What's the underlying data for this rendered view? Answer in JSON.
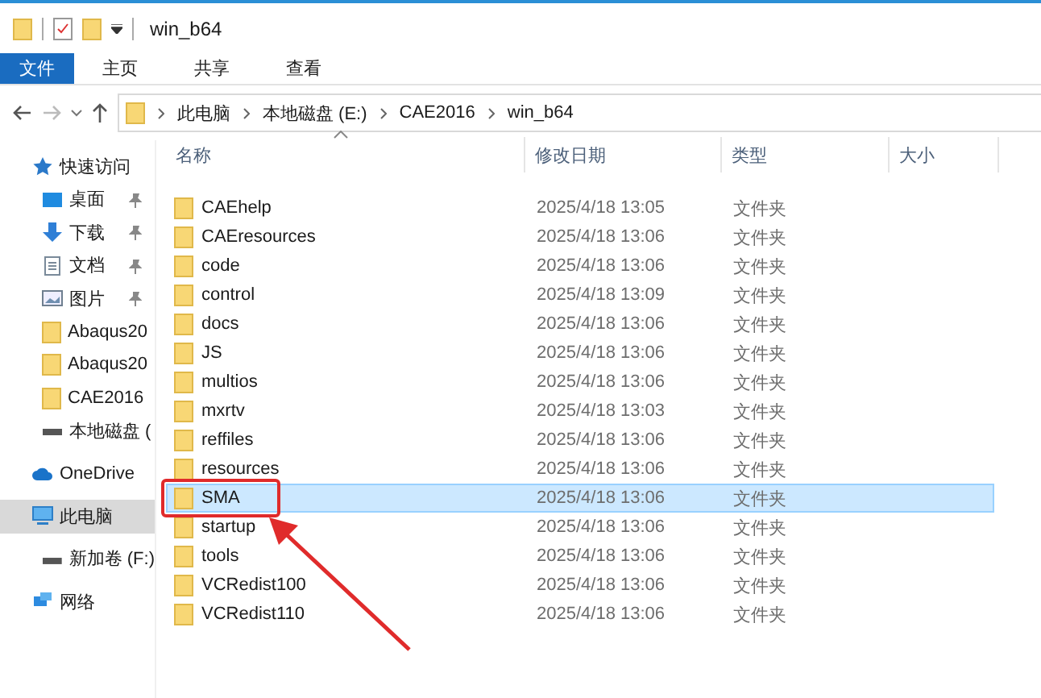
{
  "window": {
    "title": "win_b64"
  },
  "ribbon_tabs": [
    {
      "label": "文件",
      "selected": true
    },
    {
      "label": "主页",
      "selected": false
    },
    {
      "label": "共享",
      "selected": false
    },
    {
      "label": "查看",
      "selected": false
    }
  ],
  "breadcrumb": [
    "此电脑",
    "本地磁盘 (E:)",
    "CAE2016",
    "win_b64"
  ],
  "sidebar": {
    "items": [
      {
        "label": "快速访问",
        "kind": "star",
        "pinned": false,
        "selected": false
      },
      {
        "label": "桌面",
        "kind": "desktop",
        "pinned": true,
        "selected": false
      },
      {
        "label": "下载",
        "kind": "download",
        "pinned": true,
        "selected": false
      },
      {
        "label": "文档",
        "kind": "document",
        "pinned": true,
        "selected": false
      },
      {
        "label": "图片",
        "kind": "picture",
        "pinned": true,
        "selected": false
      },
      {
        "label": "Abaqus20",
        "kind": "folder",
        "pinned": false,
        "selected": false
      },
      {
        "label": "Abaqus20",
        "kind": "folder",
        "pinned": false,
        "selected": false
      },
      {
        "label": "CAE2016",
        "kind": "folder",
        "pinned": false,
        "selected": false
      },
      {
        "label": "本地磁盘 (",
        "kind": "drive",
        "pinned": false,
        "selected": false
      },
      {
        "label": "OneDrive",
        "kind": "cloud",
        "pinned": false,
        "selected": false
      },
      {
        "label": "此电脑",
        "kind": "computer",
        "pinned": false,
        "selected": true
      },
      {
        "label": "新加卷 (F:)",
        "kind": "drive",
        "pinned": false,
        "selected": false
      },
      {
        "label": "网络",
        "kind": "network",
        "pinned": false,
        "selected": false
      }
    ]
  },
  "table": {
    "columns": [
      "名称",
      "修改日期",
      "类型",
      "大小"
    ],
    "rows": [
      {
        "name": "CAEhelp",
        "date": "2025/4/18 13:05",
        "type": "文件夹",
        "selected": false
      },
      {
        "name": "CAEresources",
        "date": "2025/4/18 13:06",
        "type": "文件夹",
        "selected": false
      },
      {
        "name": "code",
        "date": "2025/4/18 13:06",
        "type": "文件夹",
        "selected": false
      },
      {
        "name": "control",
        "date": "2025/4/18 13:09",
        "type": "文件夹",
        "selected": false
      },
      {
        "name": "docs",
        "date": "2025/4/18 13:06",
        "type": "文件夹",
        "selected": false
      },
      {
        "name": "JS",
        "date": "2025/4/18 13:06",
        "type": "文件夹",
        "selected": false
      },
      {
        "name": "multios",
        "date": "2025/4/18 13:06",
        "type": "文件夹",
        "selected": false
      },
      {
        "name": "mxrtv",
        "date": "2025/4/18 13:03",
        "type": "文件夹",
        "selected": false
      },
      {
        "name": "reffiles",
        "date": "2025/4/18 13:06",
        "type": "文件夹",
        "selected": false
      },
      {
        "name": "resources",
        "date": "2025/4/18 13:06",
        "type": "文件夹",
        "selected": false
      },
      {
        "name": "SMA",
        "date": "2025/4/18 13:06",
        "type": "文件夹",
        "selected": true
      },
      {
        "name": "startup",
        "date": "2025/4/18 13:06",
        "type": "文件夹",
        "selected": false
      },
      {
        "name": "tools",
        "date": "2025/4/18 13:06",
        "type": "文件夹",
        "selected": false
      },
      {
        "name": "VCRedist100",
        "date": "2025/4/18 13:06",
        "type": "文件夹",
        "selected": false
      },
      {
        "name": "VCRedist110",
        "date": "2025/4/18 13:06",
        "type": "文件夹",
        "selected": false
      }
    ]
  }
}
